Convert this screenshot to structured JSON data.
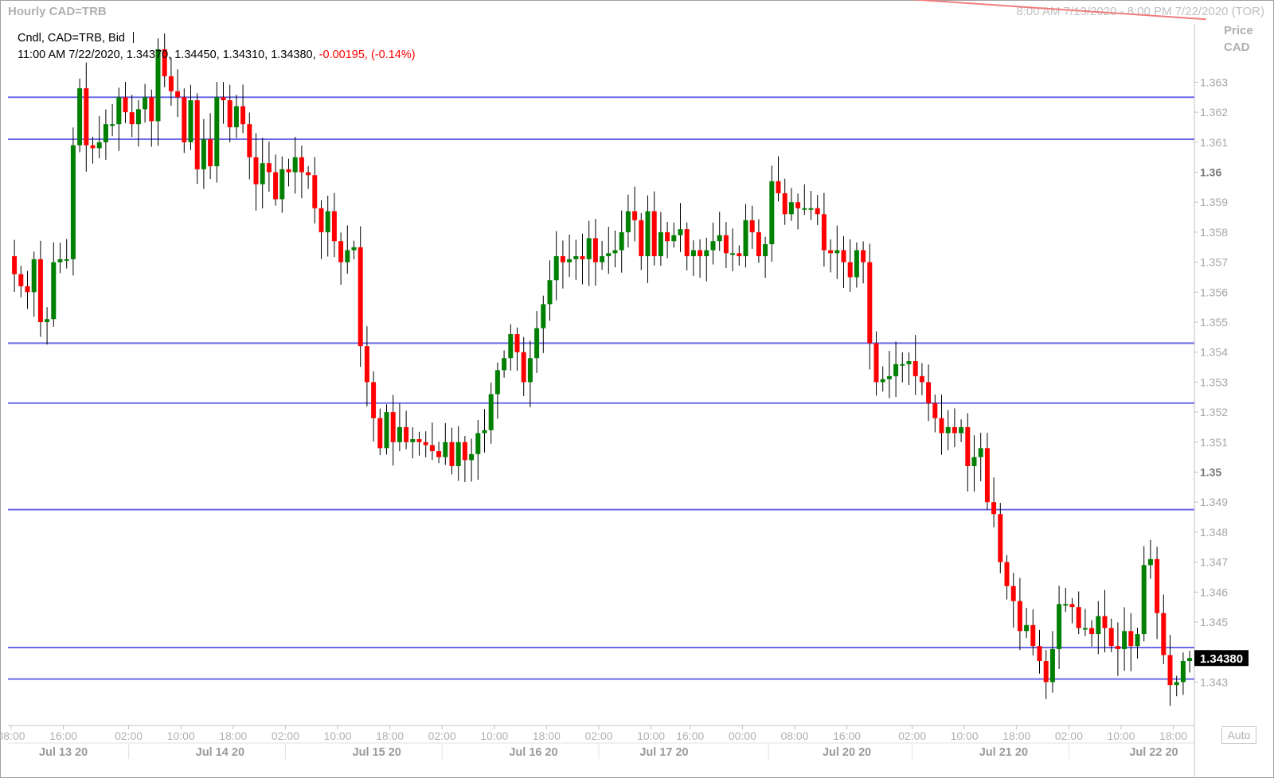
{
  "header": {
    "title": "Hourly CAD=TRB",
    "range": "8:00 AM 7/13/2020 - 8:00 PM 7/22/2020 (TOR)"
  },
  "legend": {
    "line1": "Cndl, CAD=TRB, Bid",
    "line2_main": "11:00 AM 7/22/2020, 1.34370, 1.34450, 1.34310, 1.34380,",
    "line2_change": "-0.00195, (-0.14%)"
  },
  "axis": {
    "price_label": "Price",
    "currency_label": "CAD",
    "auto_label": "Auto",
    "last_price": "1.34380"
  },
  "colors": {
    "up": "#008000",
    "down": "#ff0000",
    "hline": "#6a6ae6",
    "trendline": "#f07c7c",
    "last_price_bg": "#000000"
  },
  "chart_data": {
    "type": "candlestick",
    "title": "Hourly CAD=TRB",
    "ylabel": "Price CAD",
    "ylim": [
      1.3419,
      1.3654
    ],
    "yticks": [
      "1.363",
      "1.362",
      "1.361",
      "1.36",
      "1.359",
      "1.358",
      "1.357",
      "1.356",
      "1.355",
      "1.354",
      "1.353",
      "1.352",
      "1.351",
      "1.35",
      "1.349",
      "1.348",
      "1.347",
      "1.346",
      "1.345",
      "1.343"
    ],
    "ytick_values": [
      1.363,
      1.362,
      1.361,
      1.36,
      1.359,
      1.358,
      1.357,
      1.356,
      1.355,
      1.354,
      1.353,
      1.352,
      1.351,
      1.35,
      1.349,
      1.348,
      1.347,
      1.346,
      1.345,
      1.343
    ],
    "bold_ticks": [
      "1.36",
      "1.35"
    ],
    "time_labels": [
      "08:00",
      "16:00",
      "02:00",
      "10:00",
      "18:00",
      "02:00",
      "10:00",
      "18:00",
      "02:00",
      "10:00",
      "18:00",
      "02:00",
      "10:00",
      "16:00",
      "00:00",
      "08:00",
      "16:00",
      "02:00",
      "10:00",
      "18:00",
      "02:00",
      "10:00",
      "18:00"
    ],
    "time_label_hours": [
      0,
      8,
      18,
      26,
      34,
      42,
      50,
      58,
      66,
      74,
      82,
      90,
      98,
      104,
      112,
      120,
      128,
      138,
      146,
      154,
      162,
      170,
      178
    ],
    "date_labels": [
      "Jul 13 20",
      "Jul 14 20",
      "Jul 15 20",
      "Jul 16 20",
      "Jul 17 20",
      "Jul 20 20",
      "Jul 21 20",
      "Jul 22 20"
    ],
    "date_label_hours": [
      8,
      32,
      56,
      80,
      100,
      128,
      152,
      175
    ],
    "date_separator_hours": [
      18,
      42,
      66,
      90,
      116,
      138,
      162
    ],
    "horizontal_lines": [
      1.3625,
      1.3611,
      1.3543,
      1.3523,
      1.34875,
      1.34415,
      1.3431
    ],
    "trendline": {
      "start_hour": 128.5,
      "start_price": 1.3659,
      "end_hour": 183,
      "end_price": 1.3651
    },
    "closes": [
      1.3566,
      1.3562,
      1.356,
      1.3571,
      1.355,
      1.3551,
      1.357,
      1.3571,
      1.3571,
      1.3609,
      1.3628,
      1.3609,
      1.3608,
      1.361,
      1.3616,
      1.3616,
      1.3625,
      1.362,
      1.3616,
      1.3621,
      1.3625,
      1.3617,
      1.3641,
      1.3632,
      1.3627,
      1.3625,
      1.361,
      1.3624,
      1.3601,
      1.3611,
      1.3602,
      1.3625,
      1.3624,
      1.3615,
      1.3622,
      1.3616,
      1.3605,
      1.3596,
      1.3603,
      1.36,
      1.3591,
      1.3601,
      1.36,
      1.3605,
      1.36,
      1.3599,
      1.3588,
      1.358,
      1.3587,
      1.3577,
      1.357,
      1.3574,
      1.3575,
      1.3542,
      1.353,
      1.3518,
      1.3508,
      1.352,
      1.351,
      1.3515,
      1.351,
      1.3511,
      1.351,
      1.3509,
      1.3507,
      1.3505,
      1.351,
      1.3502,
      1.351,
      1.3504,
      1.3506,
      1.3513,
      1.3514,
      1.3526,
      1.3534,
      1.3538,
      1.3546,
      1.354,
      1.353,
      1.3538,
      1.3548,
      1.3556,
      1.3564,
      1.3572,
      1.357,
      1.3571,
      1.3572,
      1.3571,
      1.3578,
      1.357,
      1.3572,
      1.3573,
      1.3574,
      1.358,
      1.3587,
      1.3584,
      1.3572,
      1.3587,
      1.3572,
      1.358,
      1.3577,
      1.3579,
      1.3581,
      1.3572,
      1.3574,
      1.3572,
      1.3574,
      1.3577,
      1.3579,
      1.3573,
      1.3573,
      1.3572,
      1.3584,
      1.358,
      1.3572,
      1.3576,
      1.3597,
      1.3593,
      1.3586,
      1.359,
      1.3588,
      1.3588,
      1.3588,
      1.3586,
      1.3574,
      1.3573,
      1.3574,
      1.357,
      1.3565,
      1.3574,
      1.357,
      1.3543,
      1.353,
      1.3531,
      1.3532,
      1.3536,
      1.3536,
      1.3537,
      1.3532,
      1.353,
      1.3523,
      1.3518,
      1.3513,
      1.3515,
      1.3513,
      1.3515,
      1.3502,
      1.3505,
      1.3508,
      1.349,
      1.3486,
      1.347,
      1.3462,
      1.3457,
      1.3447,
      1.3449,
      1.3442,
      1.3437,
      1.343,
      1.3441,
      1.3456,
      1.3456,
      1.3455,
      1.3448,
      1.3448,
      1.3446,
      1.3452,
      1.3448,
      1.3442,
      1.3441,
      1.3447,
      1.3442,
      1.3446,
      1.3469,
      1.3471,
      1.3453,
      1.3439,
      1.3429,
      1.343,
      1.3437,
      1.3438
    ]
  }
}
